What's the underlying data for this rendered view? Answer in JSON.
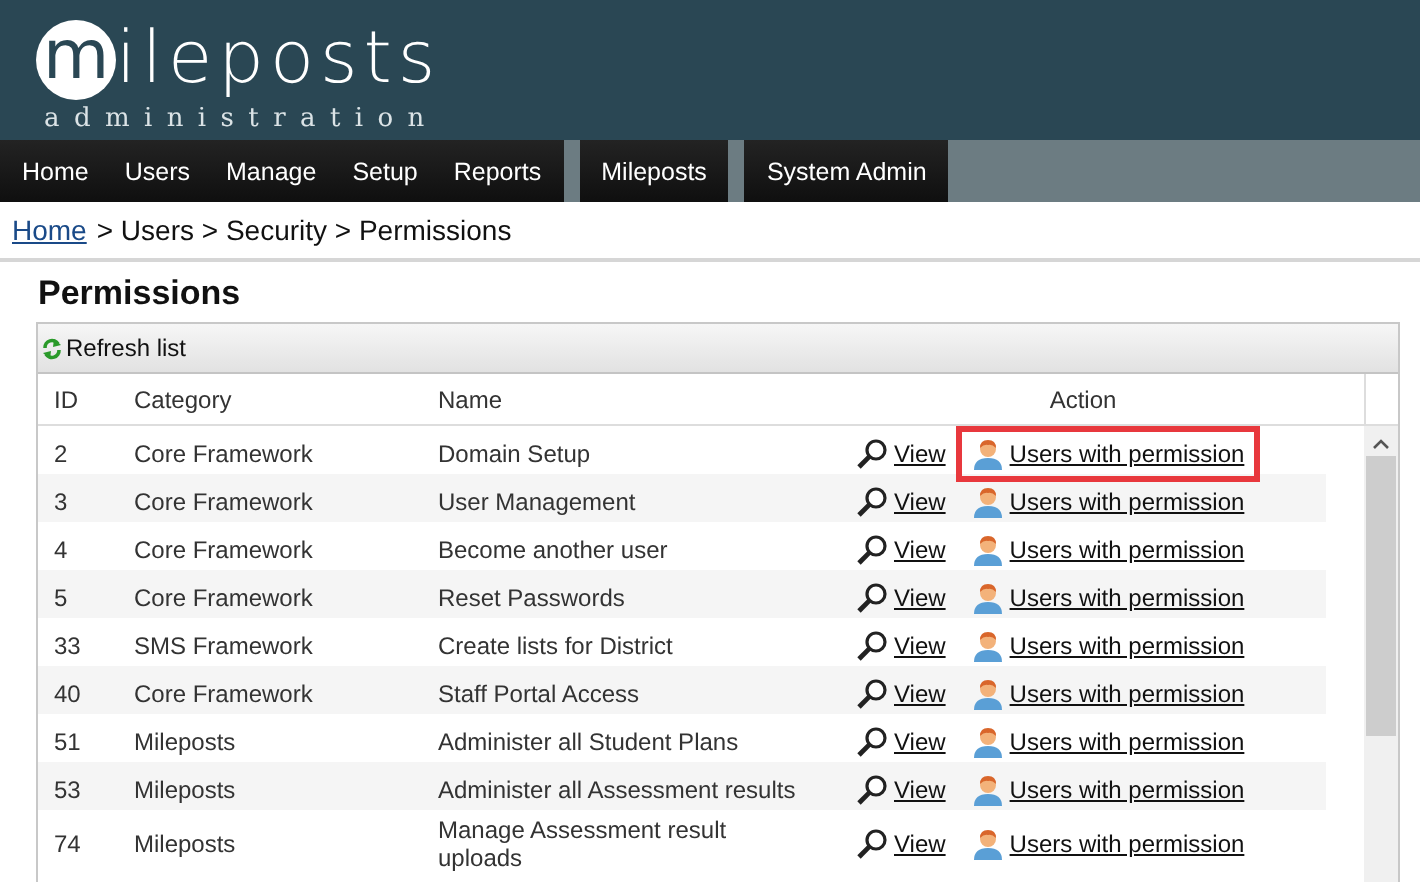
{
  "logo": {
    "initial": "m",
    "word": "ileposts",
    "subtitle": "administration"
  },
  "nav_groups": [
    {
      "items": [
        "Home",
        "Users",
        "Manage",
        "Setup",
        "Reports"
      ]
    },
    {
      "items": [
        "Mileposts"
      ]
    },
    {
      "items": [
        "System Admin"
      ]
    }
  ],
  "breadcrumb": {
    "link": "Home",
    "rest": "> Users > Security > Permissions"
  },
  "page_title": "Permissions",
  "toolbar": {
    "refresh": "Refresh list"
  },
  "table": {
    "columns": [
      "ID",
      "Category",
      "Name",
      "Action"
    ],
    "rows": [
      {
        "id": "2",
        "category": "Core Framework",
        "name": "Domain Setup",
        "view": "View",
        "users": "Users with permission",
        "highlighted": true
      },
      {
        "id": "3",
        "category": "Core Framework",
        "name": "User Management",
        "view": "View",
        "users": "Users with permission",
        "highlighted": false
      },
      {
        "id": "4",
        "category": "Core Framework",
        "name": "Become another user",
        "view": "View",
        "users": "Users with permission",
        "highlighted": false
      },
      {
        "id": "5",
        "category": "Core Framework",
        "name": "Reset Passwords",
        "view": "View",
        "users": "Users with permission",
        "highlighted": false
      },
      {
        "id": "33",
        "category": "SMS Framework",
        "name": "Create lists for District",
        "view": "View",
        "users": "Users with permission",
        "highlighted": false
      },
      {
        "id": "40",
        "category": "Core Framework",
        "name": "Staff Portal Access",
        "view": "View",
        "users": "Users with permission",
        "highlighted": false
      },
      {
        "id": "51",
        "category": "Mileposts",
        "name": "Administer all Student Plans",
        "view": "View",
        "users": "Users with permission",
        "highlighted": false
      },
      {
        "id": "53",
        "category": "Mileposts",
        "name": "Administer all Assessment results",
        "view": "View",
        "users": "Users with permission",
        "highlighted": false
      },
      {
        "id": "74",
        "category": "Mileposts",
        "name": "Manage Assessment result uploads",
        "view": "View",
        "users": "Users with permission",
        "highlighted": false
      }
    ]
  }
}
